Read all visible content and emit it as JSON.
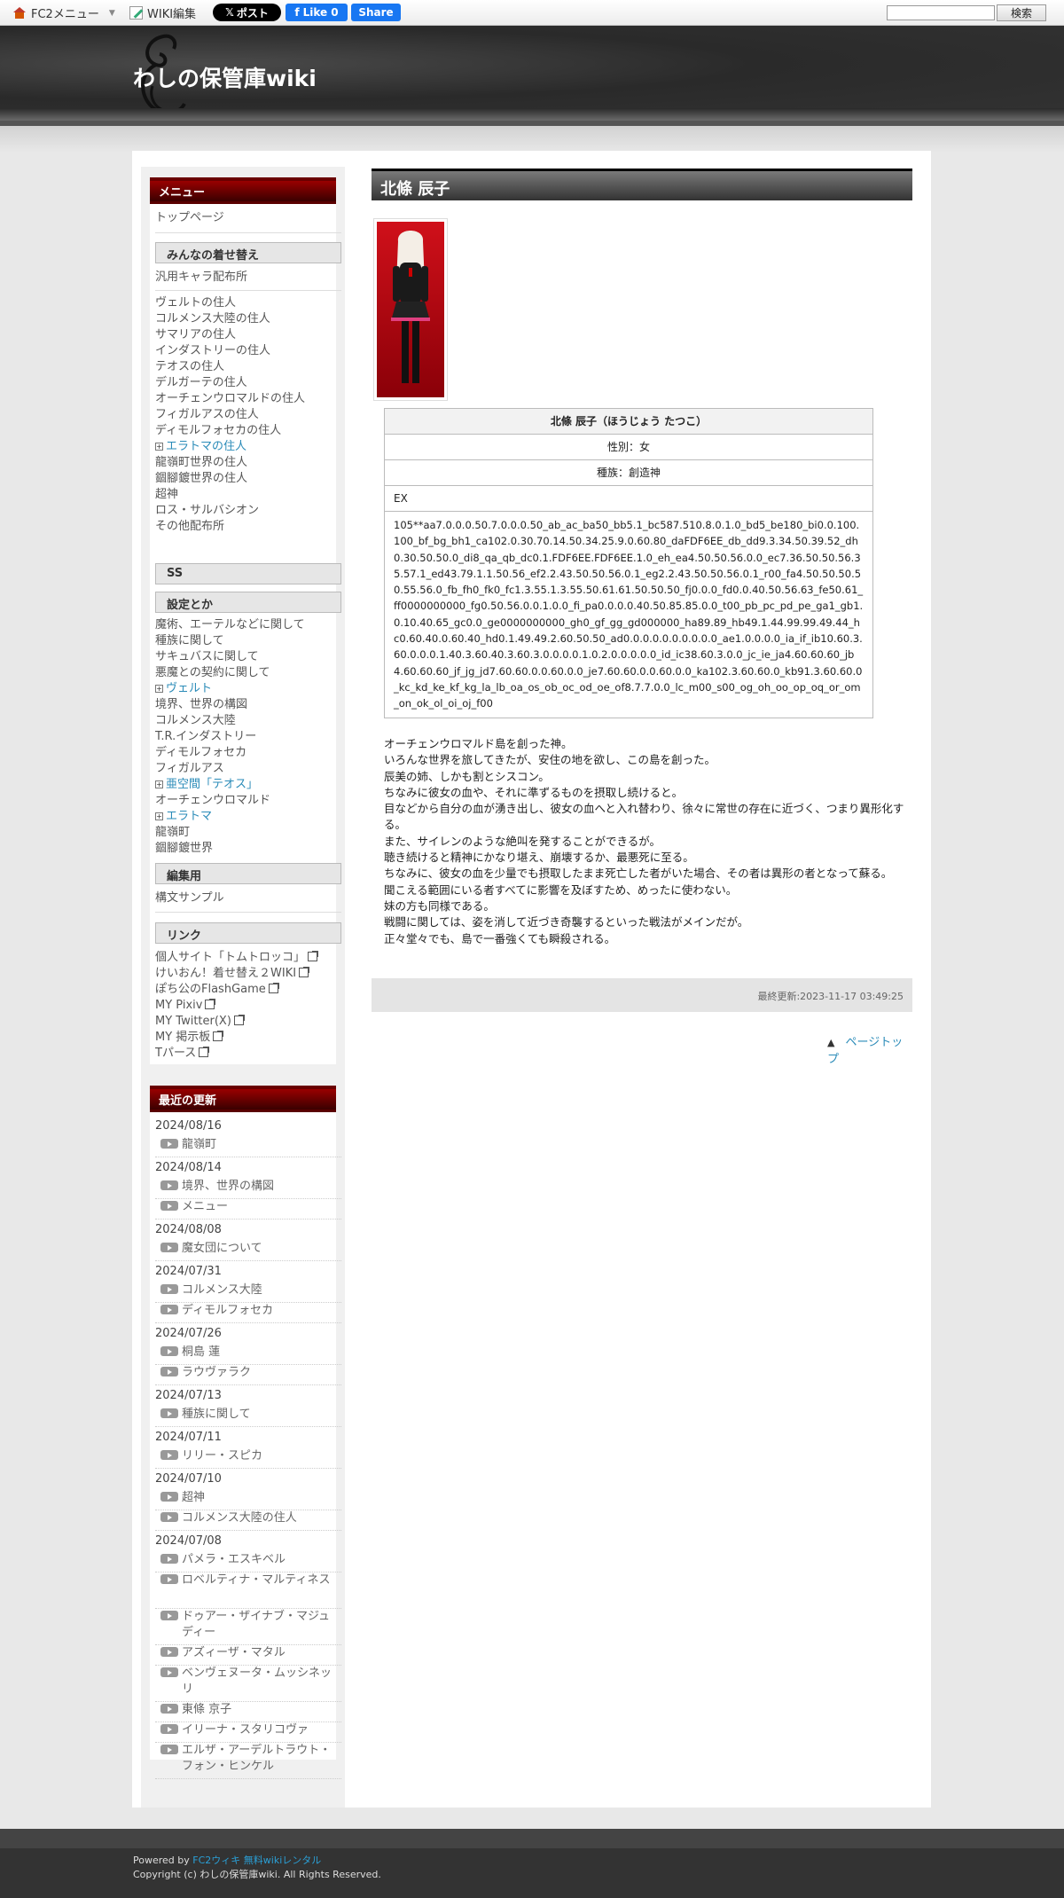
{
  "topbar": {
    "fc2_menu": "FC2メニュー",
    "wiki_edit": "WIKI編集",
    "x_post": "ポスト",
    "fb_like": "Like 0",
    "fb_share": "Share",
    "search_button": "検索",
    "search_value": ""
  },
  "header": {
    "site_title": "わしの保管庫wiki"
  },
  "sidebar": {
    "menu_title": "メニュー",
    "top_page": "トップページ",
    "sec_kisekae": "みんなの着せ替え",
    "generic_chars": "汎用キャラ配布所",
    "residents": [
      "ヴェルトの住人",
      "コルメンス大陸の住人",
      "サマリアの住人",
      "インダストリーの住人",
      "テオスの住人",
      "デルガーテの住人",
      "オーチェンウロマルドの住人",
      "フィガルアスの住人",
      "ディモルフォセカの住人",
      "エラトマの住人",
      "龍嶺町世界の住人",
      "錮腳鍍世界の住人",
      "超神",
      "ロス・サルバシオン",
      "その他配布所"
    ],
    "sec_ss": "SS",
    "sec_settings": "設定とか",
    "settings": [
      "魔術、エーテルなどに関して",
      "種族に関して",
      "サキュバスに関して",
      "悪魔との契約に関して",
      "ヴェルト",
      "境界、世界の構図",
      "コルメンス大陸",
      "T.R.インダストリー",
      "ディモルフォセカ",
      "フィガルアス",
      "亜空間「テオス」",
      "オーチェンウロマルド",
      "エラトマ",
      "龍嶺町",
      "錮腳鍍世界"
    ],
    "sec_edit": "編集用",
    "syntax_sample": "構文サンプル",
    "sec_links": "リンク",
    "links": [
      "個人サイト「トムトロッコ」",
      "けいおん！着せ替え２WIKI",
      "ぽち公のFlashGame",
      "MY Pixiv",
      "MY Twitter(X)",
      "MY 掲示板",
      "Tパース"
    ],
    "recent_title": "最近の更新",
    "recent": [
      {
        "date": "2024/08/16",
        "items": [
          "龍嶺町"
        ]
      },
      {
        "date": "2024/08/14",
        "items": [
          "境界、世界の構図",
          "メニュー"
        ]
      },
      {
        "date": "2024/08/08",
        "items": [
          "魔女団について"
        ]
      },
      {
        "date": "2024/07/31",
        "items": [
          "コルメンス大陸",
          "ディモルフォセカ"
        ]
      },
      {
        "date": "2024/07/26",
        "items": [
          "桐島 蓮",
          "ラウヴァラク"
        ]
      },
      {
        "date": "2024/07/13",
        "items": [
          "種族に関して"
        ]
      },
      {
        "date": "2024/07/11",
        "items": [
          "リリー・スピカ"
        ]
      },
      {
        "date": "2024/07/10",
        "items": [
          "超神",
          "コルメンス大陸の住人"
        ]
      },
      {
        "date": "2024/07/08",
        "items": [
          "パメラ・エスキベル",
          "ロベルティナ・マルティネス",
          "ドゥアー・ザイナブ・マジュディー",
          "アズィーザ・マタル",
          "ベンヴェヌータ・ムッシネッリ",
          "東條 京子",
          "イリーナ・スタリコヴァ",
          "エルザ・アーデルトラウト・フォン・ヒンケル"
        ]
      }
    ]
  },
  "main": {
    "page_title": "北條 辰子",
    "table": {
      "name": "北條 辰子（ほうじょう たつこ）",
      "gender": "性別：女",
      "race": "種族：創造神",
      "ex_label": "EX",
      "ex_code": "105**aa7.0.0.0.50.7.0.0.0.50_ab_ac_ba50_bb5.1_bc587.510.8.0.1.0_bd5_be180_bi0.0.100.100_bf_bg_bh1_ca102.0.30.70.14.50.34.25.9.0.60.80_daFDF6EE_db_dd9.3.34.50.39.52_dh0.30.50.50.0_di8_qa_qb_dc0.1.FDF6EE.FDF6EE.1.0_eh_ea4.50.50.56.0.0_ec7.36.50.50.56.35.57.1_ed43.79.1.1.50.56_ef2.2.43.50.50.56.0.1_eg2.2.43.50.50.56.0.1_r00_fa4.50.50.50.50.55.56.0_fb_fh0_fk0_fc1.3.55.1.3.55.50.61.61.50.50.50_fj0.0.0_fd0.0.40.50.56.63_fe50.61_ff0000000000_fg0.50.56.0.0.1.0.0_fi_pa0.0.0.0.40.50.85.85.0.0_t00_pb_pc_pd_pe_ga1_gb1.0.10.40.65_gc0.0_ge0000000000_gh0_gf_gg_gd000000_ha89.89_hb49.1.44.99.99.49.44_hc0.60.40.0.60.40_hd0.1.49.49.2.60.50.50_ad0.0.0.0.0.0.0.0.0.0_ae1.0.0.0.0_ia_if_ib10.60.3.60.0.0.0.1.40.3.60.40.3.60.3.0.0.0.0.1.0.2.0.0.0.0.0_id_ic38.60.3.0.0_jc_ie_ja4.60.60.60_jb4.60.60.60_jf_jg_jd7.60.60.0.0.60.0.0_je7.60.60.0.0.60.0.0_ka102.3.60.60.0_kb91.3.60.60.0_kc_kd_ke_kf_kg_la_lb_oa_os_ob_oc_od_oe_of8.7.7.0.0_lc_m00_s00_og_oh_oo_op_oq_or_om_on_ok_ol_oi_oj_f00"
    },
    "description": [
      "オーチェンウロマルド島を創った神。",
      "いろんな世界を旅してきたが、安住の地を欲し、この島を創った。",
      "辰美の姉、しかも割とシスコン。",
      "ちなみに彼女の血や、それに準ずるものを摂取し続けると。",
      "目などから自分の血が湧き出し、彼女の血へと入れ替わり、徐々に常世の存在に近づく、つまり異形化する。",
      "また、サイレンのような絶叫を発することができるが。",
      "聴き続けると精神にかなり堪え、崩壊するか、最悪死に至る。",
      "ちなみに、彼女の血を少量でも摂取したまま死亡した者がいた場合、その者は異形の者となって蘇る。",
      "聞こえる範囲にいる者すべてに影響を及ぼすため、めったに使わない。",
      "妹の方も同様である。",
      "戦闘に関しては、姿を消して近づき奇襲するといった戦法がメインだが。",
      "正々堂々でも、島で一番強くても瞬殺される。"
    ],
    "last_updated": "最終更新:2023-11-17 03:49:25",
    "page_top": "ページトップ"
  },
  "footer": {
    "powered_by": "Powered by",
    "fc2_link": "FC2ウィキ 無料wikiレンタル",
    "copyright": "Copyright (c) わしの保管庫wiki. All Rights Reserved."
  }
}
